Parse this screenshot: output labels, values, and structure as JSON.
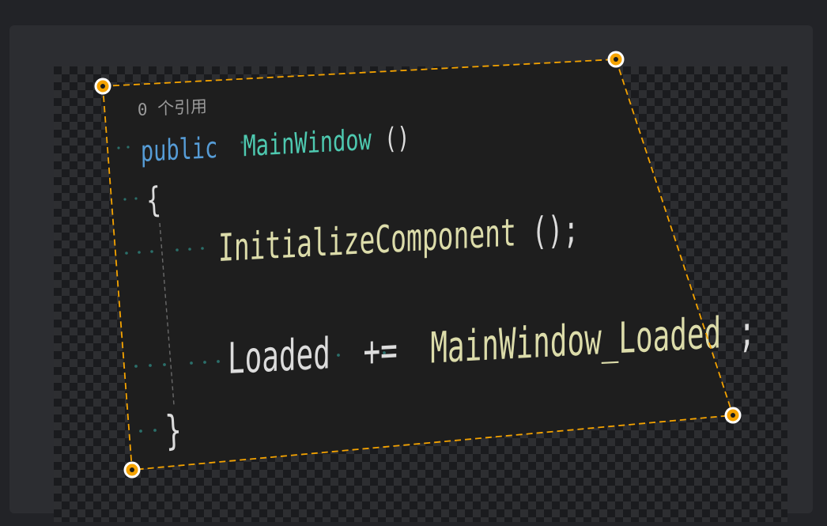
{
  "code_view": {
    "codelens": "0 个引用",
    "line1_keyword": "public",
    "line1_name": "MainWindow",
    "line1_parens": "()",
    "open_brace": "{",
    "line3_call": "InitializeComponent",
    "line3_parens": "();",
    "line5_target": "Loaded",
    "line5_op": "+=",
    "line5_handler": "MainWindow_Loaded",
    "line5_semicolon": ";",
    "close_brace": "}"
  },
  "colors": {
    "code_background": "#1e1e1e",
    "keyword": "#569cd6",
    "type_name": "#4ec9b0",
    "method": "#dcdcaa",
    "plain_text": "#dcdcdc",
    "codelens": "#9a9a9a",
    "whitespace_dots": "#2b6f6a",
    "selection_outline": "#f5a300",
    "checkerboard_light": "#2d2e31",
    "checkerboard_dark": "#1a1b1e"
  },
  "handles": [
    "top-left",
    "top-right",
    "bottom-right",
    "bottom-left"
  ]
}
